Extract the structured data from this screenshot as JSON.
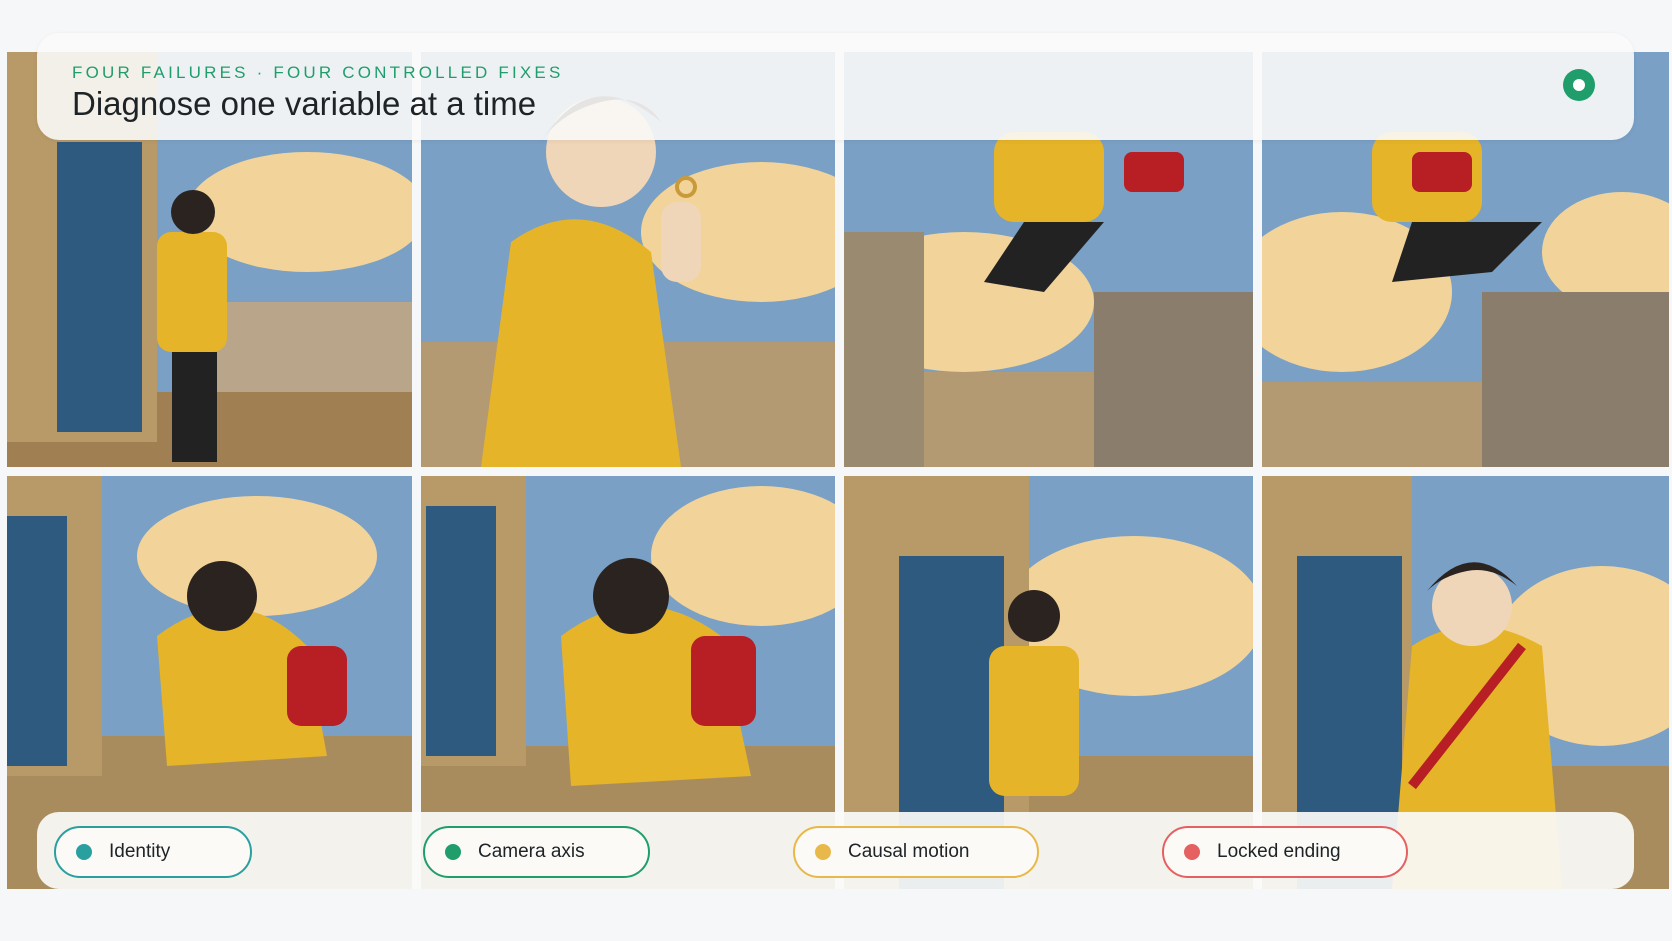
{
  "header": {
    "eyebrow": "FOUR FAILURES · FOUR CONTROLLED FIXES",
    "title": "Diagnose one variable at a time",
    "status_color": "#1f9e6b"
  },
  "legend": [
    {
      "label": "Identity",
      "color": "#2a9fa0"
    },
    {
      "label": "Camera axis",
      "color": "#1f9e6b"
    },
    {
      "label": "Causal motion",
      "color": "#e8b84a"
    },
    {
      "label": "Locked ending",
      "color": "#e56060"
    }
  ],
  "colors": {
    "jacket": "#e5b428",
    "bag": "#b71f24",
    "door": "#2f5a7f",
    "sky": "#6f9ac8"
  }
}
